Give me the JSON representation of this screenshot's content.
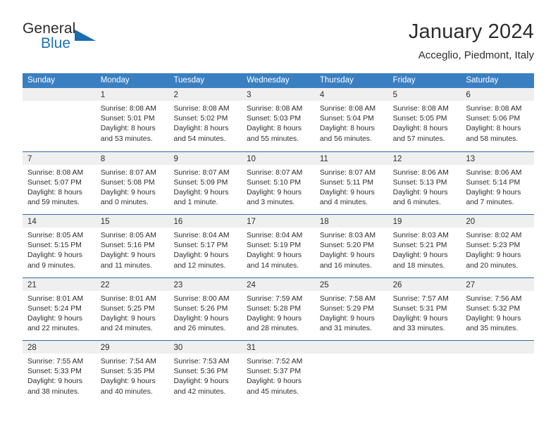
{
  "brand": {
    "name_top": "General",
    "name_bottom": "Blue",
    "triangle_icon": "triangle-icon",
    "color_dark": "#2b2b2b",
    "color_blue": "#1d72b8"
  },
  "header": {
    "title": "January 2024",
    "subtitle": "Acceglio, Piedmont, Italy"
  },
  "theme": {
    "header_bg": "#3a7fc1",
    "header_text": "#ffffff",
    "week_divider": "#2f6ca8",
    "daynum_band": "#efefef",
    "cell_bg": "#ffffff",
    "text": "#2d2d2d"
  },
  "weekdays": [
    "Sunday",
    "Monday",
    "Tuesday",
    "Wednesday",
    "Thursday",
    "Friday",
    "Saturday"
  ],
  "weeks": [
    [
      {
        "day": "",
        "lines": []
      },
      {
        "day": "1",
        "lines": [
          "Sunrise: 8:08 AM",
          "Sunset: 5:01 PM",
          "Daylight: 8 hours",
          "and 53 minutes."
        ]
      },
      {
        "day": "2",
        "lines": [
          "Sunrise: 8:08 AM",
          "Sunset: 5:02 PM",
          "Daylight: 8 hours",
          "and 54 minutes."
        ]
      },
      {
        "day": "3",
        "lines": [
          "Sunrise: 8:08 AM",
          "Sunset: 5:03 PM",
          "Daylight: 8 hours",
          "and 55 minutes."
        ]
      },
      {
        "day": "4",
        "lines": [
          "Sunrise: 8:08 AM",
          "Sunset: 5:04 PM",
          "Daylight: 8 hours",
          "and 56 minutes."
        ]
      },
      {
        "day": "5",
        "lines": [
          "Sunrise: 8:08 AM",
          "Sunset: 5:05 PM",
          "Daylight: 8 hours",
          "and 57 minutes."
        ]
      },
      {
        "day": "6",
        "lines": [
          "Sunrise: 8:08 AM",
          "Sunset: 5:06 PM",
          "Daylight: 8 hours",
          "and 58 minutes."
        ]
      }
    ],
    [
      {
        "day": "7",
        "lines": [
          "Sunrise: 8:08 AM",
          "Sunset: 5:07 PM",
          "Daylight: 8 hours",
          "and 59 minutes."
        ]
      },
      {
        "day": "8",
        "lines": [
          "Sunrise: 8:07 AM",
          "Sunset: 5:08 PM",
          "Daylight: 9 hours",
          "and 0 minutes."
        ]
      },
      {
        "day": "9",
        "lines": [
          "Sunrise: 8:07 AM",
          "Sunset: 5:09 PM",
          "Daylight: 9 hours",
          "and 1 minute."
        ]
      },
      {
        "day": "10",
        "lines": [
          "Sunrise: 8:07 AM",
          "Sunset: 5:10 PM",
          "Daylight: 9 hours",
          "and 3 minutes."
        ]
      },
      {
        "day": "11",
        "lines": [
          "Sunrise: 8:07 AM",
          "Sunset: 5:11 PM",
          "Daylight: 9 hours",
          "and 4 minutes."
        ]
      },
      {
        "day": "12",
        "lines": [
          "Sunrise: 8:06 AM",
          "Sunset: 5:13 PM",
          "Daylight: 9 hours",
          "and 6 minutes."
        ]
      },
      {
        "day": "13",
        "lines": [
          "Sunrise: 8:06 AM",
          "Sunset: 5:14 PM",
          "Daylight: 9 hours",
          "and 7 minutes."
        ]
      }
    ],
    [
      {
        "day": "14",
        "lines": [
          "Sunrise: 8:05 AM",
          "Sunset: 5:15 PM",
          "Daylight: 9 hours",
          "and 9 minutes."
        ]
      },
      {
        "day": "15",
        "lines": [
          "Sunrise: 8:05 AM",
          "Sunset: 5:16 PM",
          "Daylight: 9 hours",
          "and 11 minutes."
        ]
      },
      {
        "day": "16",
        "lines": [
          "Sunrise: 8:04 AM",
          "Sunset: 5:17 PM",
          "Daylight: 9 hours",
          "and 12 minutes."
        ]
      },
      {
        "day": "17",
        "lines": [
          "Sunrise: 8:04 AM",
          "Sunset: 5:19 PM",
          "Daylight: 9 hours",
          "and 14 minutes."
        ]
      },
      {
        "day": "18",
        "lines": [
          "Sunrise: 8:03 AM",
          "Sunset: 5:20 PM",
          "Daylight: 9 hours",
          "and 16 minutes."
        ]
      },
      {
        "day": "19",
        "lines": [
          "Sunrise: 8:03 AM",
          "Sunset: 5:21 PM",
          "Daylight: 9 hours",
          "and 18 minutes."
        ]
      },
      {
        "day": "20",
        "lines": [
          "Sunrise: 8:02 AM",
          "Sunset: 5:23 PM",
          "Daylight: 9 hours",
          "and 20 minutes."
        ]
      }
    ],
    [
      {
        "day": "21",
        "lines": [
          "Sunrise: 8:01 AM",
          "Sunset: 5:24 PM",
          "Daylight: 9 hours",
          "and 22 minutes."
        ]
      },
      {
        "day": "22",
        "lines": [
          "Sunrise: 8:01 AM",
          "Sunset: 5:25 PM",
          "Daylight: 9 hours",
          "and 24 minutes."
        ]
      },
      {
        "day": "23",
        "lines": [
          "Sunrise: 8:00 AM",
          "Sunset: 5:26 PM",
          "Daylight: 9 hours",
          "and 26 minutes."
        ]
      },
      {
        "day": "24",
        "lines": [
          "Sunrise: 7:59 AM",
          "Sunset: 5:28 PM",
          "Daylight: 9 hours",
          "and 28 minutes."
        ]
      },
      {
        "day": "25",
        "lines": [
          "Sunrise: 7:58 AM",
          "Sunset: 5:29 PM",
          "Daylight: 9 hours",
          "and 31 minutes."
        ]
      },
      {
        "day": "26",
        "lines": [
          "Sunrise: 7:57 AM",
          "Sunset: 5:31 PM",
          "Daylight: 9 hours",
          "and 33 minutes."
        ]
      },
      {
        "day": "27",
        "lines": [
          "Sunrise: 7:56 AM",
          "Sunset: 5:32 PM",
          "Daylight: 9 hours",
          "and 35 minutes."
        ]
      }
    ],
    [
      {
        "day": "28",
        "lines": [
          "Sunrise: 7:55 AM",
          "Sunset: 5:33 PM",
          "Daylight: 9 hours",
          "and 38 minutes."
        ]
      },
      {
        "day": "29",
        "lines": [
          "Sunrise: 7:54 AM",
          "Sunset: 5:35 PM",
          "Daylight: 9 hours",
          "and 40 minutes."
        ]
      },
      {
        "day": "30",
        "lines": [
          "Sunrise: 7:53 AM",
          "Sunset: 5:36 PM",
          "Daylight: 9 hours",
          "and 42 minutes."
        ]
      },
      {
        "day": "31",
        "lines": [
          "Sunrise: 7:52 AM",
          "Sunset: 5:37 PM",
          "Daylight: 9 hours",
          "and 45 minutes."
        ]
      },
      {
        "day": "",
        "lines": []
      },
      {
        "day": "",
        "lines": []
      },
      {
        "day": "",
        "lines": []
      }
    ]
  ]
}
